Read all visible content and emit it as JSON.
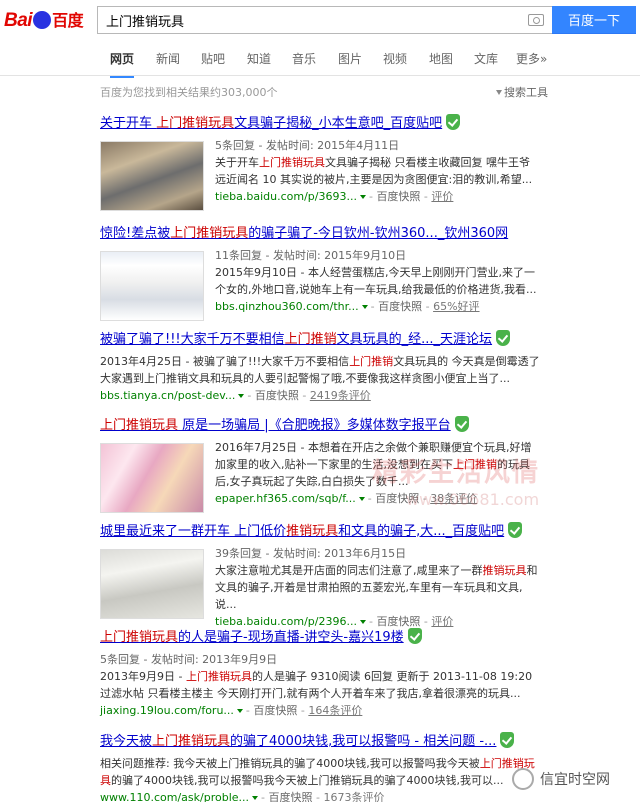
{
  "brand": {
    "logo_text": "Bai",
    "logo_text2": "百度"
  },
  "search": {
    "query": "上门推销玩具",
    "button_label": "百度一下"
  },
  "nav": [
    "网页",
    "新闻",
    "贴吧",
    "知道",
    "音乐",
    "图片",
    "视频",
    "地图",
    "文库",
    "更多»"
  ],
  "stats": "百度为您找到相关结果约303,000个",
  "tools_label": "搜索工具",
  "results": [
    {
      "title_pre": "关于开车 ",
      "title_hl": "上门推销玩具",
      "title_post": "文具骗子揭秘_小本生意吧_百度贴吧",
      "meta": "5条回复 - 发帖时间: 2015年4月11日",
      "desc_pre": "关于开车",
      "desc_hl": "上门推销玩具",
      "desc_post": "文具骗子揭秘 只看楼主收藏回复 嘿牛王爷 远近闻名 10 其实说的被片,主要是因为贪图便宜:泪的教训,希望...",
      "source": "tieba.baidu.com/p/3693...",
      "cache": "百度快照",
      "evals": "评价"
    },
    {
      "title_pre": "惊险!差点被",
      "title_hl": "上门推销玩具",
      "title_post": "的骗子骗了-今日钦州-钦州360..._钦州360网",
      "meta": "11条回复 - 发帖时间: 2015年9月10日",
      "desc_pre": "2015年9月10日 - 本人经营蛋糕店,今天早上刚刚开门营业,来了一个女的,外地口音,说她车上有一车玩具,给我最低的价格进货,我看...",
      "desc_hl": "",
      "desc_post": "",
      "source": "bbs.qinzhou360.com/thr...",
      "cache": "百度快照",
      "evals": "65%好评"
    },
    {
      "title_pre": "被骗了骗了!!!大家千万不要相信",
      "title_hl": "上门推销",
      "title_post": "文具玩具的_经..._天涯论坛",
      "meta": "",
      "desc_pre": "2013年4月25日 - 被骗了骗了!!!大家千万不要相信",
      "desc_hl": "上门推销",
      "desc_post": "文具玩具的 今天真是倒霉透了 大家遇到上门推销文具和玩具的人要引起警惕了哦,不要像我这样贪图小便宜上当了...",
      "source": "bbs.tianya.cn/post-dev...",
      "cache": "百度快照",
      "evals": "2419条评价"
    },
    {
      "title_pre": "",
      "title_hl": "上门推销玩具",
      "title_post": " 原是一场骗局 |《合肥晚报》多媒体数字报平台",
      "meta": "",
      "desc_pre": "2016年7月25日 - 本想着在开店之余做个兼职赚便宜个玩具,好增加家里的收入,贴补一下家里的生活,没想到在买下",
      "desc_hl": "上门推销",
      "desc_post": "的玩具后,女子真玩起了失踪,白白损失了数千...",
      "source": "epaper.hf365.com/sqb/f...",
      "cache": "百度快照",
      "evals": "38条评价"
    },
    {
      "title_pre": "城里最近来了一群开车 上门低价",
      "title_hl": "推销玩具",
      "title_post": "和文具的骗子,大..._百度贴吧",
      "meta": "39条回复 - 发帖时间: 2013年6月15日",
      "desc_pre": "大家注意啦尤其是开店面的同志们注意了,咸里来了一群",
      "desc_hl": "推销玩具",
      "desc_post": "和文具的骗子,开着是甘肃拍照的五菱宏光,车里有一车玩具和文具,说...",
      "source": "tieba.baidu.com/p/2396...",
      "cache": "百度快照",
      "evals": "评价"
    },
    {
      "title_pre": "",
      "title_hl": "上门推销玩具",
      "title_post": "的人是骗子-现场直播-讲空头-嘉兴19楼",
      "meta": "5条回复 - 发帖时间: 2013年9月9日",
      "desc_pre": "2013年9月9日 - ",
      "desc_hl": "上门推销玩具",
      "desc_post": "的人是骗子 9310阅读 6回复 更新于 2013-11-08 19:20 过滤水帖 只看楼主楼主 今天刚打开门,就有两个人开着车来了我店,拿着很漂亮的玩具...",
      "source": "jiaxing.19lou.com/foru...",
      "cache": "百度快照",
      "evals": "164条评价"
    },
    {
      "title_pre": "我今天被",
      "title_hl": "上门推销玩具",
      "title_post": "的骗了4000块钱,我可以报警吗 - 相关问题 -...",
      "meta": "",
      "desc_pre": "相关问题推荐: 我今天被上门推销玩具的骗了4000块钱,我可以报警吗我今天被",
      "desc_hl": "上门推销玩具",
      "desc_post": "的骗了4000块钱,我可以报警吗我今天被上门推销玩具的骗了4000块钱,我可以...",
      "source": "www.110.com/ask/proble...",
      "cache": "百度快照",
      "evals": "1673条评价"
    }
  ],
  "watermarks": {
    "main": "精彩生活风情",
    "url": "www.06681.com",
    "account": "信宜时空网"
  }
}
